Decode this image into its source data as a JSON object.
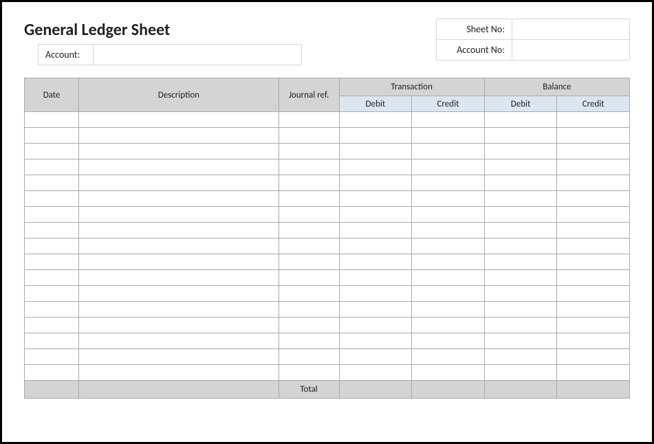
{
  "title": "General Ledger Sheet",
  "meta": {
    "sheet_no_label": "Sheet No:",
    "sheet_no_value": "",
    "account_no_label": "Account No:",
    "account_no_value": "",
    "account_label": "Account:",
    "account_value": ""
  },
  "columns": {
    "date": "Date",
    "description": "Description",
    "journal_ref": "Journal ref.",
    "transaction": "Transaction",
    "balance": "Balance",
    "debit": "Debit",
    "credit": "Credit"
  },
  "rows": [
    {
      "date": "",
      "description": "",
      "journal_ref": "",
      "t_debit": "",
      "t_credit": "",
      "b_debit": "",
      "b_credit": ""
    },
    {
      "date": "",
      "description": "",
      "journal_ref": "",
      "t_debit": "",
      "t_credit": "",
      "b_debit": "",
      "b_credit": ""
    },
    {
      "date": "",
      "description": "",
      "journal_ref": "",
      "t_debit": "",
      "t_credit": "",
      "b_debit": "",
      "b_credit": ""
    },
    {
      "date": "",
      "description": "",
      "journal_ref": "",
      "t_debit": "",
      "t_credit": "",
      "b_debit": "",
      "b_credit": ""
    },
    {
      "date": "",
      "description": "",
      "journal_ref": "",
      "t_debit": "",
      "t_credit": "",
      "b_debit": "",
      "b_credit": ""
    },
    {
      "date": "",
      "description": "",
      "journal_ref": "",
      "t_debit": "",
      "t_credit": "",
      "b_debit": "",
      "b_credit": ""
    },
    {
      "date": "",
      "description": "",
      "journal_ref": "",
      "t_debit": "",
      "t_credit": "",
      "b_debit": "",
      "b_credit": ""
    },
    {
      "date": "",
      "description": "",
      "journal_ref": "",
      "t_debit": "",
      "t_credit": "",
      "b_debit": "",
      "b_credit": ""
    },
    {
      "date": "",
      "description": "",
      "journal_ref": "",
      "t_debit": "",
      "t_credit": "",
      "b_debit": "",
      "b_credit": ""
    },
    {
      "date": "",
      "description": "",
      "journal_ref": "",
      "t_debit": "",
      "t_credit": "",
      "b_debit": "",
      "b_credit": ""
    },
    {
      "date": "",
      "description": "",
      "journal_ref": "",
      "t_debit": "",
      "t_credit": "",
      "b_debit": "",
      "b_credit": ""
    },
    {
      "date": "",
      "description": "",
      "journal_ref": "",
      "t_debit": "",
      "t_credit": "",
      "b_debit": "",
      "b_credit": ""
    },
    {
      "date": "",
      "description": "",
      "journal_ref": "",
      "t_debit": "",
      "t_credit": "",
      "b_debit": "",
      "b_credit": ""
    },
    {
      "date": "",
      "description": "",
      "journal_ref": "",
      "t_debit": "",
      "t_credit": "",
      "b_debit": "",
      "b_credit": ""
    },
    {
      "date": "",
      "description": "",
      "journal_ref": "",
      "t_debit": "",
      "t_credit": "",
      "b_debit": "",
      "b_credit": ""
    },
    {
      "date": "",
      "description": "",
      "journal_ref": "",
      "t_debit": "",
      "t_credit": "",
      "b_debit": "",
      "b_credit": ""
    },
    {
      "date": "",
      "description": "",
      "journal_ref": "",
      "t_debit": "",
      "t_credit": "",
      "b_debit": "",
      "b_credit": ""
    }
  ],
  "footer": {
    "total_label": "Total",
    "t_debit": "",
    "t_credit": "",
    "b_debit": "",
    "b_credit": ""
  }
}
